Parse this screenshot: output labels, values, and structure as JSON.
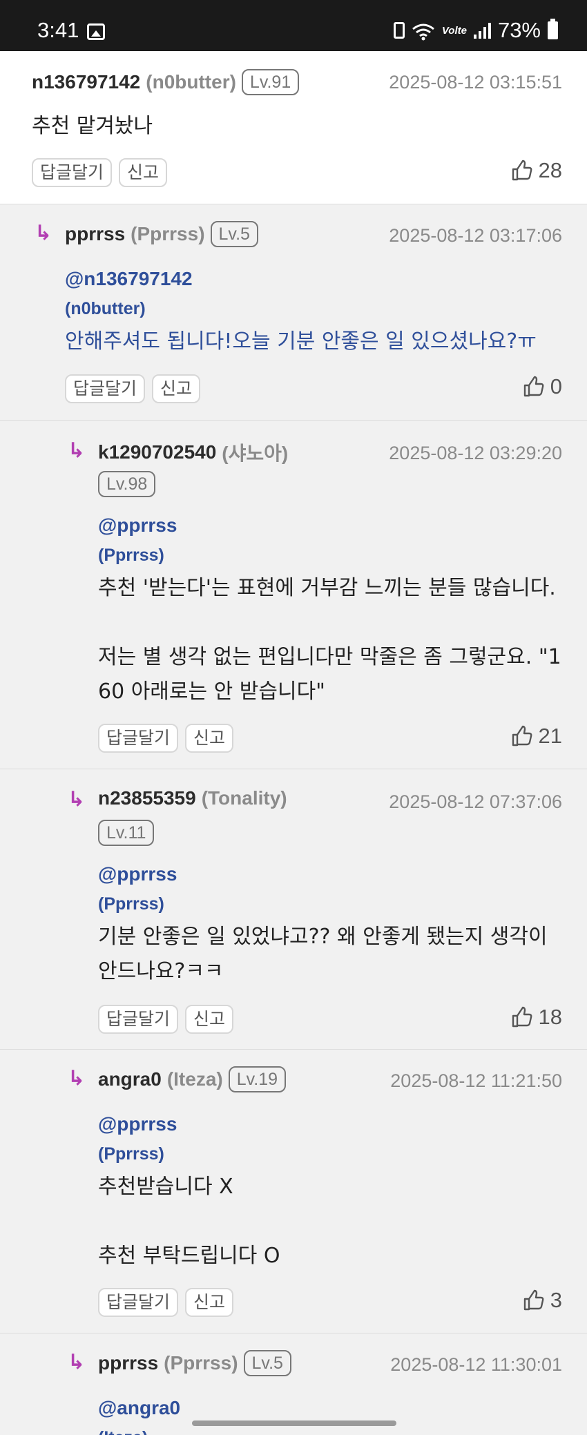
{
  "status_bar": {
    "time": "3:41",
    "volte": "Volte",
    "battery": "73%"
  },
  "buttons": {
    "reply": "답글달기",
    "report": "신고"
  },
  "reply_arrow": "↳",
  "comments": [
    {
      "uid": "n136797142",
      "nick": "(n0butter)",
      "level": "Lv.91",
      "date": "2025-08-12 03:15:51",
      "text": "추천 맡겨놨나",
      "likes": "28"
    },
    {
      "uid": "pprrss",
      "nick": "(Pprrss)",
      "level": "Lv.5",
      "date": "2025-08-12 03:17:06",
      "mention": "@n136797142",
      "mention_nick": "(n0butter)",
      "text": "안해주셔도 됩니다!오늘 기분 안좋은 일 있으셨나요?ㅠ",
      "likes": "0"
    },
    {
      "uid": "k1290702540",
      "nick": "(샤노아)",
      "level": "Lv.98",
      "date": "2025-08-12 03:29:20",
      "mention": "@pprrss",
      "mention_nick": "(Pprrss)",
      "text": "추천 '받는다'는 표현에 거부감 느끼는 분들 많습니다.\n\n저는 별 생각 없는 편입니다만 막줄은 좀 그렇군요. \"1\n60 아래로는 안 받습니다\"",
      "likes": "21"
    },
    {
      "uid": "n23855359",
      "nick": "(Tonality)",
      "level": "Lv.11",
      "date": "2025-08-12 07:37:06",
      "mention": "@pprrss",
      "mention_nick": "(Pprrss)",
      "text": "기분 안좋은 일 있었냐고?? 왜 안좋게 됐는지 생각이\n안드나요?ㅋㅋ",
      "likes": "18"
    },
    {
      "uid": "angra0",
      "nick": "(Iteza)",
      "level": "Lv.19",
      "date": "2025-08-12 11:21:50",
      "mention": "@pprrss",
      "mention_nick": "(Pprrss)",
      "text": "추천받습니다 X\n\n추천 부탁드립니다 O",
      "likes": "3"
    },
    {
      "uid": "pprrss",
      "nick": "(Pprrss)",
      "level": "Lv.5",
      "date": "2025-08-12 11:30:01",
      "mention": "@angra0",
      "mention_nick": "(Iteza)"
    }
  ]
}
